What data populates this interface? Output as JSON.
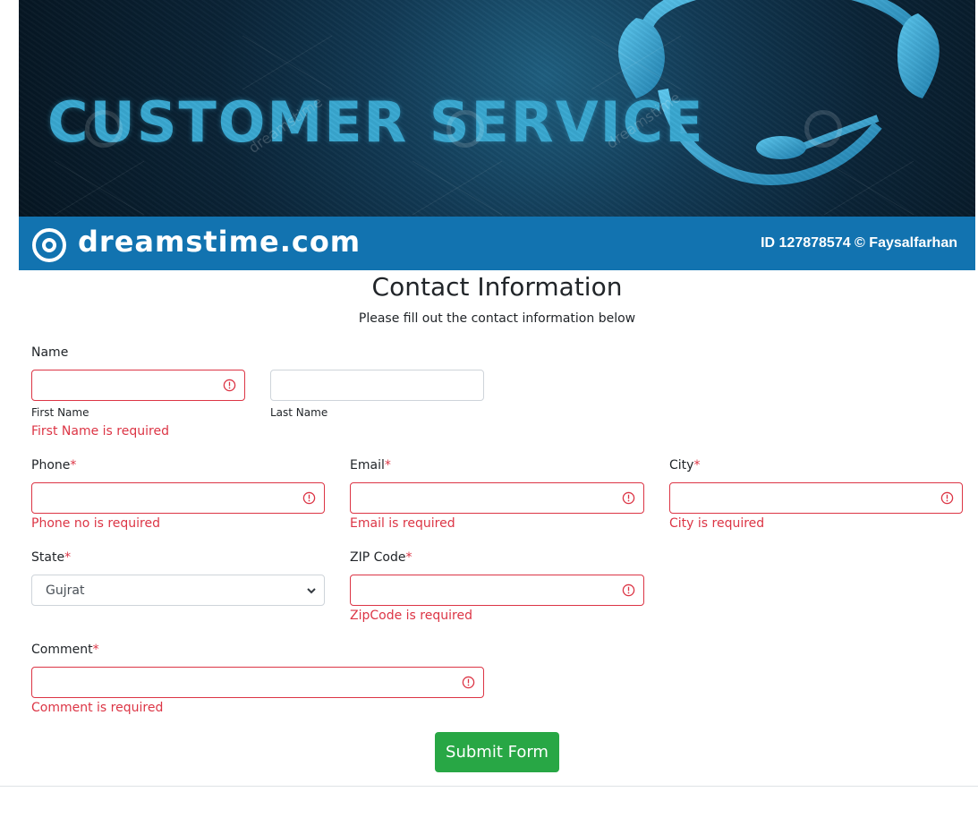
{
  "banner": {
    "title": "CUSTOMER SERVICE",
    "watermark": "dreamstime",
    "brand": "dreamstime.com",
    "image_id": "ID 127878574 © Faysalfarhan"
  },
  "page": {
    "title": "Contact Information",
    "subtitle": "Please fill out the contact information below"
  },
  "form": {
    "name": {
      "label": "Name",
      "first_sublabel": "First Name",
      "last_sublabel": "Last Name",
      "first_error": "First Name is required",
      "first_value": "",
      "last_value": ""
    },
    "phone": {
      "label": "Phone",
      "required_mark": "*",
      "error": "Phone no is required",
      "value": ""
    },
    "email": {
      "label": "Email",
      "required_mark": "*",
      "error": "Email is required",
      "value": ""
    },
    "city": {
      "label": "City",
      "required_mark": "*",
      "error": "City is required",
      "value": ""
    },
    "state": {
      "label": "State",
      "required_mark": "*",
      "selected": "Gujrat"
    },
    "zip": {
      "label": "ZIP Code",
      "required_mark": "*",
      "error": "ZipCode is required",
      "value": ""
    },
    "comment": {
      "label": "Comment",
      "required_mark": "*",
      "error": "Comment is required",
      "value": ""
    },
    "submit_label": "Submit Form"
  },
  "colors": {
    "error": "#dc3545",
    "submit": "#28a745",
    "banner_bar": "#1273b0",
    "title_cyan": "#39a8d1"
  },
  "icons": {
    "error": "exclamation-circle-icon",
    "select": "chevron-down-icon",
    "brand": "dreamstime-swirl-icon"
  }
}
